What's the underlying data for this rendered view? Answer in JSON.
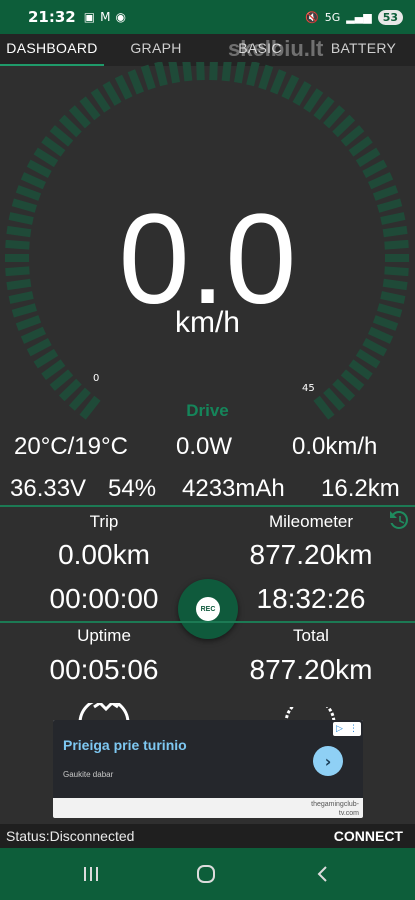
{
  "status_bar": {
    "time": "21:32",
    "left_icons": [
      "screenshot-icon",
      "mail-icon",
      "messenger-icon"
    ],
    "right_icons": [
      "mute-icon",
      "5g-icon",
      "signal-icon"
    ],
    "network": "5G",
    "battery": "53"
  },
  "tabs": [
    {
      "label": "DASHBOARD",
      "active": true
    },
    {
      "label": "GRAPH",
      "active": false
    },
    {
      "label": "BASIC",
      "active": false
    },
    {
      "label": "BATTERY",
      "active": false
    }
  ],
  "watermark": "skelbiu.lt",
  "gauge": {
    "speed": "0.0",
    "unit": "km/h",
    "min": "0",
    "max": "45",
    "mode": "Drive",
    "level": 0
  },
  "readings": {
    "temperature": "20°C/19°C",
    "power": "0.0W",
    "speed": "0.0km/h",
    "voltage": "36.33V",
    "battery_percent": "54%",
    "capacity": "4233mAh",
    "range": "16.2km"
  },
  "stats": {
    "trip_label": "Trip",
    "trip_distance": "0.00km",
    "trip_time": "00:00:00",
    "mileometer_label": "Mileometer",
    "mileometer_value": "877.20km",
    "clock": "18:32:26",
    "uptime_label": "Uptime",
    "uptime_value": "00:05:06",
    "total_label": "Total",
    "total_value": "877.20km",
    "rec_label": "REC"
  },
  "ad": {
    "title": "Prieiga prie turinio",
    "subtitle": "Gaukite dabar",
    "source": "thegamingclub-tv.com",
    "badge": "▷"
  },
  "bottom": {
    "status": "Status:Disconnected",
    "connect": "CONNECT"
  },
  "colors": {
    "accent": "#1f9a6a",
    "dark_green": "#0d5e3a",
    "background": "#2f2f2f",
    "gauge_tick": "#1f4a38"
  }
}
